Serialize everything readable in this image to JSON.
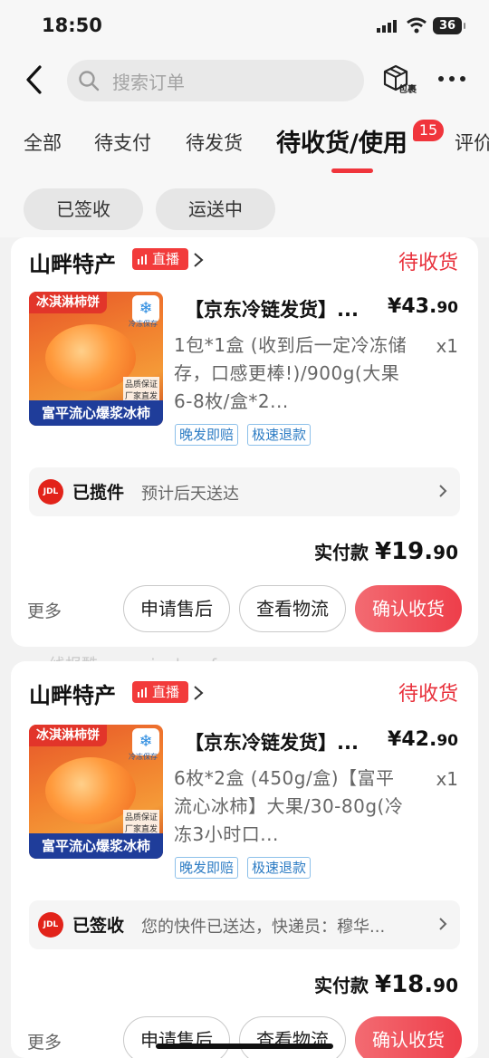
{
  "status_bar": {
    "time": "18:50",
    "battery": "36"
  },
  "header": {
    "search_placeholder": "搜索订单",
    "package_label": "包裹"
  },
  "tabs": [
    {
      "label": "全部"
    },
    {
      "label": "待支付"
    },
    {
      "label": "待发货"
    },
    {
      "label": "待收货/使用",
      "badge": "15"
    },
    {
      "label": "评价"
    }
  ],
  "filters": [
    {
      "label": "已签收"
    },
    {
      "label": "运送中"
    }
  ],
  "orders": [
    {
      "shop": "山畔特产",
      "live": "直播",
      "status": "待收货",
      "thumb": {
        "top": "冰淇淋柿饼",
        "cold": "冷冻保存",
        "quality": "品质保证\n厂家直发",
        "bottom": "富平流心爆浆冰柿"
      },
      "title": "【京东冷链发货】...",
      "price_int": "¥43.",
      "price_dec": "90",
      "spec": "1包*1盒 (收到后一定冷冻储存，口感更棒!)/900g(大果6-8枚/盒*2...",
      "qty": "x1",
      "tags": [
        "晚发即赔",
        "极速退款"
      ],
      "logistics": {
        "carrier": "JDL",
        "state": "已揽件",
        "text": "预计后天送达"
      },
      "paid_label": "实付款",
      "paid_int": "¥19.",
      "paid_dec": "90",
      "more": "更多",
      "buttons": [
        "申请售后",
        "查看物流",
        "确认收货"
      ]
    },
    {
      "shop": "山畔特产",
      "live": "直播",
      "status": "待收货",
      "thumb": {
        "top": "冰淇淋柿饼",
        "cold": "冷冻保存",
        "quality": "品质保证\n厂家直发",
        "bottom": "富平流心爆浆冰柿"
      },
      "title": "【京东冷链发货】...",
      "price_int": "¥42.",
      "price_dec": "90",
      "spec": "6枚*2盒 (450g/盒)【富平流心冰柿】大果/30-80g(冷冻3小时口...",
      "qty": "x1",
      "tags": [
        "晚发即赔",
        "极速退款"
      ],
      "logistics": {
        "carrier": "JDL",
        "state": "已签收",
        "text": "您的快件已送达，快递员：穆华..."
      },
      "paid_label": "实付款",
      "paid_int": "¥18.",
      "paid_dec": "90",
      "more": "更多",
      "buttons": [
        "申请售后",
        "查看物流",
        "确认收货"
      ]
    }
  ],
  "watermark": "线报酷-new.xianbao.fun",
  "colors": {
    "accent": "#f0353c",
    "status_red": "#e8303b",
    "tag_blue": "#2d7cc4",
    "confirm_gradient": [
      "#f36b72",
      "#ee3e4a"
    ]
  }
}
